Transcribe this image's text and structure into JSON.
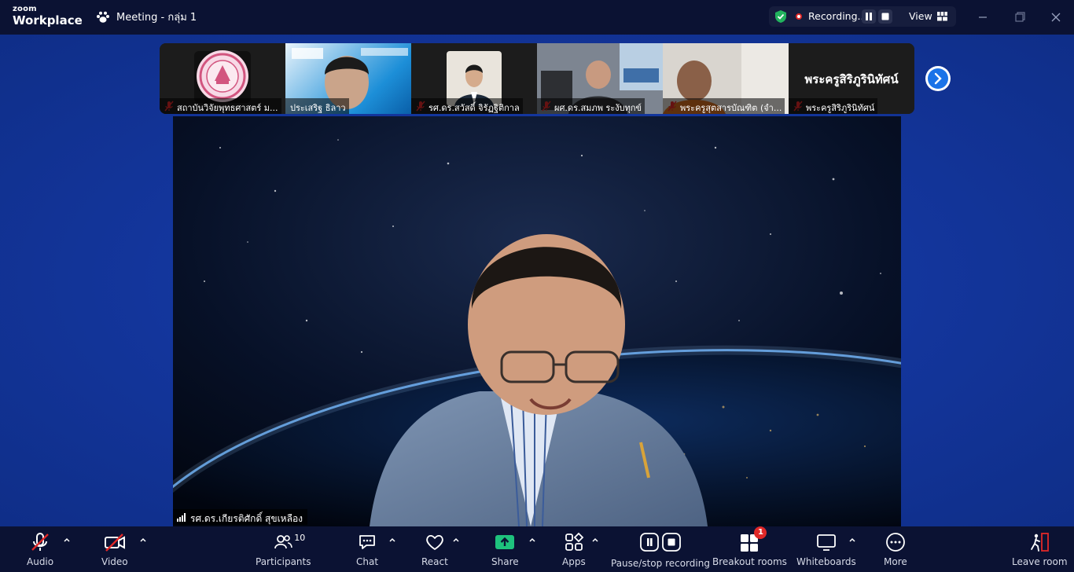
{
  "app": {
    "brand_line1": "zoom",
    "brand_line2": "Workplace",
    "meeting_title": "Meeting - กลุ่ม 1"
  },
  "recording": {
    "status_label": "Recording...",
    "view_label": "View"
  },
  "participants_strip": [
    {
      "name": "สถาบันวิจัยพุทธศาสตร์ ม...",
      "muted": true
    },
    {
      "name": "ประเสริฐ ธิลาว",
      "muted": false
    },
    {
      "name": "รศ.ดร.สวัสดิ์ จิรัฏฐิติกาล",
      "muted": true
    },
    {
      "name": "ผศ.ดร.สมภพ  ระงับทุกข์",
      "muted": true
    },
    {
      "name": "พระครูสุตสารบัณฑิต (จำ...",
      "muted": true
    },
    {
      "name": "พระครูสิริภูรินิทัศน์",
      "muted": true,
      "big_label": "พระครูสิริภูรินิทัศน์"
    }
  ],
  "main_video": {
    "speaker_name": "รศ.ดร.เกียรติศักดิ์ สุขเหลือง"
  },
  "toolbar": {
    "audio": "Audio",
    "video": "Video",
    "participants": "Participants",
    "participants_count": "10",
    "chat": "Chat",
    "react": "React",
    "share": "Share",
    "apps": "Apps",
    "pause_stop_recording": "Pause/stop recording",
    "breakout_rooms": "Breakout rooms",
    "breakout_badge": "1",
    "whiteboards": "Whiteboards",
    "more": "More",
    "leave_room": "Leave room"
  },
  "colors": {
    "titlebar": "#0b1233",
    "stage_blue": "#1437a0",
    "mute_red": "#e02828",
    "share_green": "#1ec27d",
    "shield_green": "#22b35e"
  }
}
